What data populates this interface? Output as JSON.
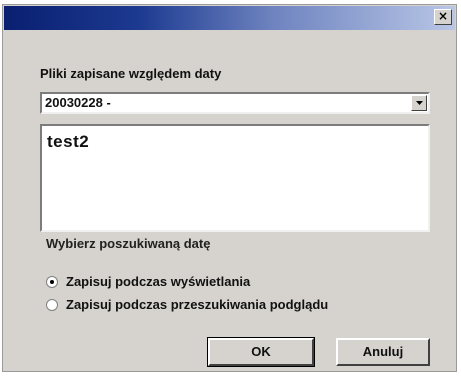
{
  "window": {
    "close_glyph": "×"
  },
  "group": {
    "label": "Pliki zapisane względem daty"
  },
  "combo": {
    "value": "20030228 -"
  },
  "list": {
    "items": [
      "test2"
    ]
  },
  "choose": {
    "label": "Wybierz poszukiwaną datę"
  },
  "options": [
    {
      "label": "Zapisuj podczas wyświetlania",
      "checked": true
    },
    {
      "label": "Zapisuj podczas przeszukiwania podglądu",
      "checked": false
    }
  ],
  "buttons": {
    "ok": "OK",
    "cancel": "Anuluj"
  },
  "colors": {
    "titlebar_start": "#0a1f70",
    "titlebar_end": "#b8c6e6",
    "dialog_bg": "#d6d3ce"
  }
}
